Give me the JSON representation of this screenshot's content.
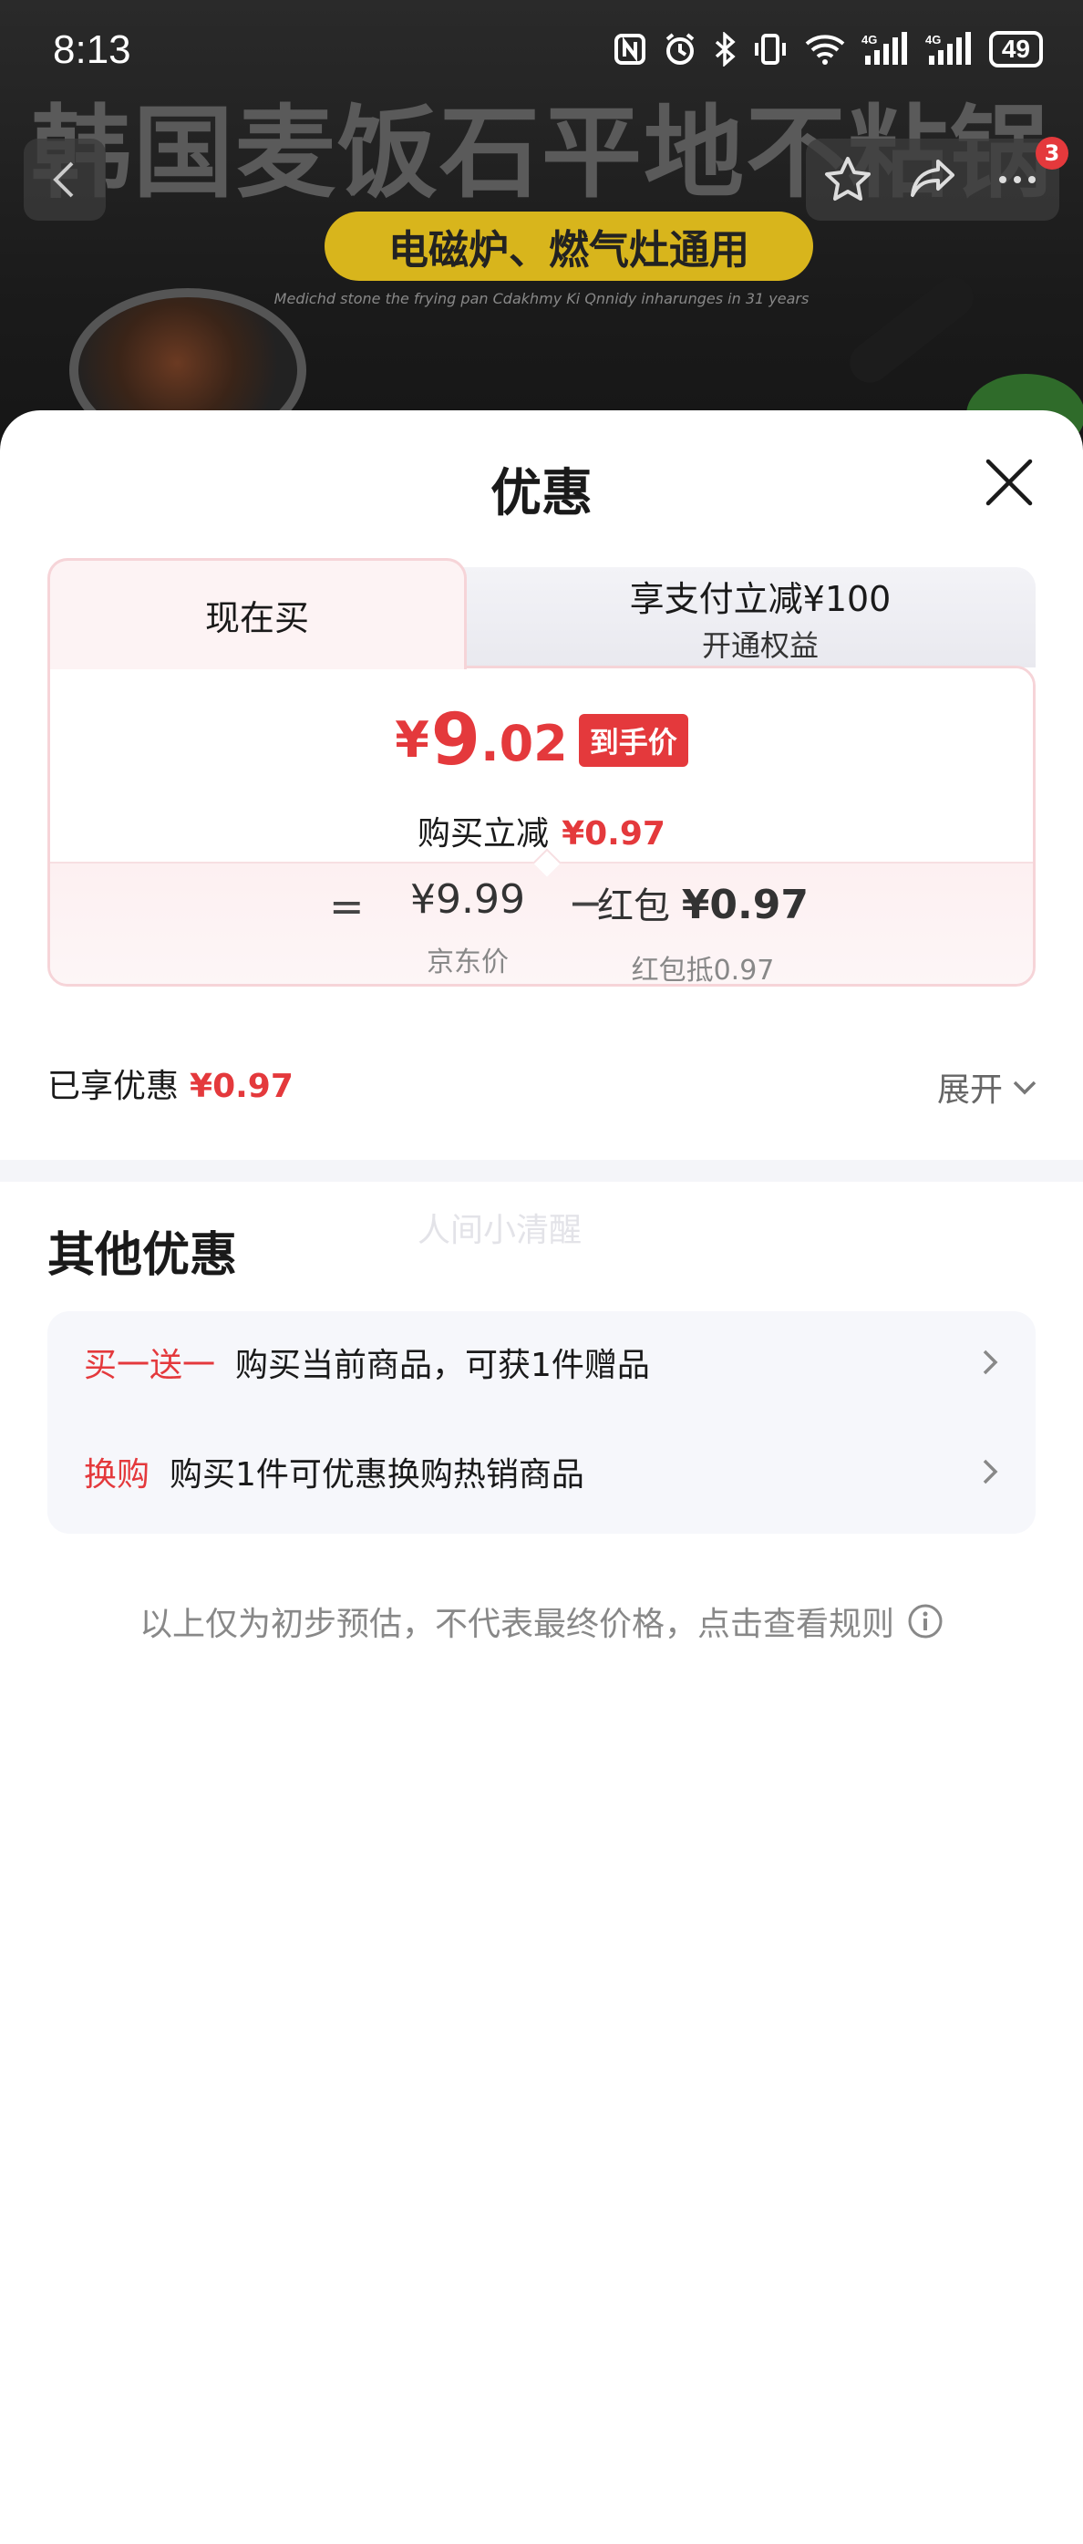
{
  "status_bar": {
    "time": "8:13",
    "battery": "49",
    "icons": [
      "nfc-icon",
      "alarm-icon",
      "bluetooth-icon",
      "vibrate-icon",
      "wifi-icon",
      "signal-4g-icon",
      "signal-4g-icon",
      "battery-icon"
    ]
  },
  "banner": {
    "title": "韩国麦饭石平地不粘锅",
    "pill": "电磁炉、燃气灶通用",
    "subtitle": "Medichd stone the frying pan Cdakhmy Ki Qnnidy inharunges in 31 years"
  },
  "nav": {
    "cart_badge": "3",
    "icons": [
      "back-arrow-icon",
      "star-icon",
      "share-icon",
      "more-icon"
    ]
  },
  "sheet": {
    "title": "优惠",
    "close_icon": "close-icon"
  },
  "tabs": {
    "active_label": "现在买",
    "inactive_line1": "享支付立减¥100",
    "inactive_line2": "开通权益"
  },
  "price": {
    "symbol": "¥",
    "integer": "9",
    "decimal": ".02",
    "tag": "到手价",
    "reduce_label": "购买立减",
    "reduce_value": "¥0.97"
  },
  "calc": {
    "equals": "=",
    "jd_price": "¥9.99",
    "jd_caption": "京东价",
    "minus": "−",
    "red_label": "红包",
    "red_value": "¥0.97",
    "red_caption": "红包抵0.97"
  },
  "enjoyed": {
    "label": "已享优惠",
    "value": "¥0.97",
    "expand_label": "展开"
  },
  "watermark": "人间小清醒",
  "other": {
    "title": "其他优惠",
    "rows": [
      {
        "tag": "买一送一",
        "text": "购买当前商品，可获1件赠品"
      },
      {
        "tag": "换购",
        "text": "购买1件可优惠换购热销商品"
      }
    ]
  },
  "footnote": "以上仅为初步预估，不代表最终价格，点击查看规则",
  "colors": {
    "accent_red": "#e4393c",
    "card_border": "#f6d4d8",
    "panel_gray": "#f6f7fb"
  }
}
